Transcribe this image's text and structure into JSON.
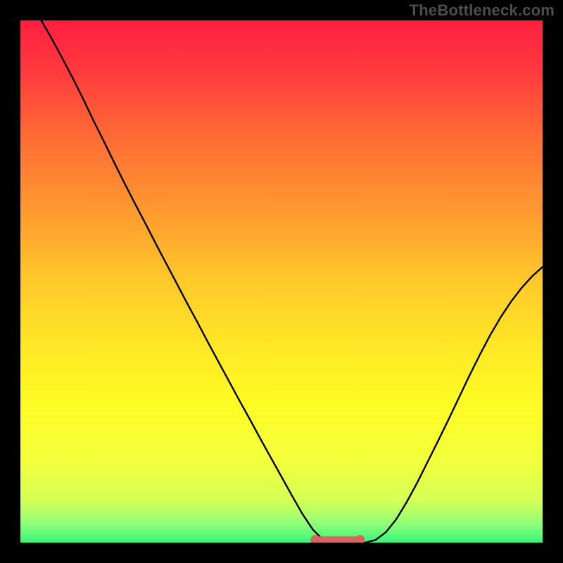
{
  "watermark": "TheBottleneck.com",
  "colors": {
    "background_black": "#000000",
    "gradient_stops": [
      {
        "offset": 0.0,
        "color": "#ff1e42"
      },
      {
        "offset": 0.1,
        "color": "#ff3b3d"
      },
      {
        "offset": 0.22,
        "color": "#ff6a36"
      },
      {
        "offset": 0.35,
        "color": "#ff9430"
      },
      {
        "offset": 0.5,
        "color": "#ffc92a"
      },
      {
        "offset": 0.62,
        "color": "#ffe626"
      },
      {
        "offset": 0.73,
        "color": "#fdfb23"
      },
      {
        "offset": 0.84,
        "color": "#f3ff3b"
      },
      {
        "offset": 0.92,
        "color": "#d5ff55"
      },
      {
        "offset": 0.965,
        "color": "#8fff7a"
      },
      {
        "offset": 1.0,
        "color": "#36f57a"
      }
    ],
    "curve_stroke": "#000000",
    "flat_segment": "#d6655f"
  },
  "chart_data": {
    "type": "line",
    "title": "",
    "xlabel": "",
    "ylabel": "",
    "xlim": [
      0,
      1
    ],
    "ylim": [
      0,
      1
    ],
    "x": [
      0.04,
      0.06,
      0.08,
      0.1,
      0.12,
      0.14,
      0.16,
      0.18,
      0.2,
      0.22,
      0.24,
      0.26,
      0.28,
      0.3,
      0.32,
      0.34,
      0.36,
      0.38,
      0.4,
      0.42,
      0.44,
      0.46,
      0.48,
      0.5,
      0.52,
      0.54,
      0.56,
      0.58,
      0.6,
      0.62,
      0.64,
      0.66,
      0.68,
      0.7,
      0.72,
      0.74,
      0.76,
      0.78,
      0.8,
      0.82,
      0.84,
      0.86,
      0.88,
      0.9,
      0.92,
      0.94,
      0.96,
      0.98,
      1.0
    ],
    "values": [
      1.0,
      0.965,
      0.928,
      0.89,
      0.85,
      0.808,
      0.768,
      0.727,
      0.687,
      0.648,
      0.61,
      0.571,
      0.533,
      0.495,
      0.457,
      0.42,
      0.382,
      0.345,
      0.308,
      0.271,
      0.235,
      0.198,
      0.162,
      0.126,
      0.09,
      0.055,
      0.025,
      0.005,
      0.0,
      0.0,
      0.0,
      0.0,
      0.005,
      0.02,
      0.045,
      0.078,
      0.115,
      0.155,
      0.195,
      0.236,
      0.278,
      0.32,
      0.36,
      0.398,
      0.432,
      0.462,
      0.488,
      0.51,
      0.528
    ],
    "flat_segment": {
      "x_start": 0.565,
      "x_end": 0.65,
      "y": 0.005
    },
    "note": "V-shaped curve on vertical rainbow gradient; y increases upward, origin bottom-left; values estimated from pixels, no axes/ticks/labels visible."
  }
}
